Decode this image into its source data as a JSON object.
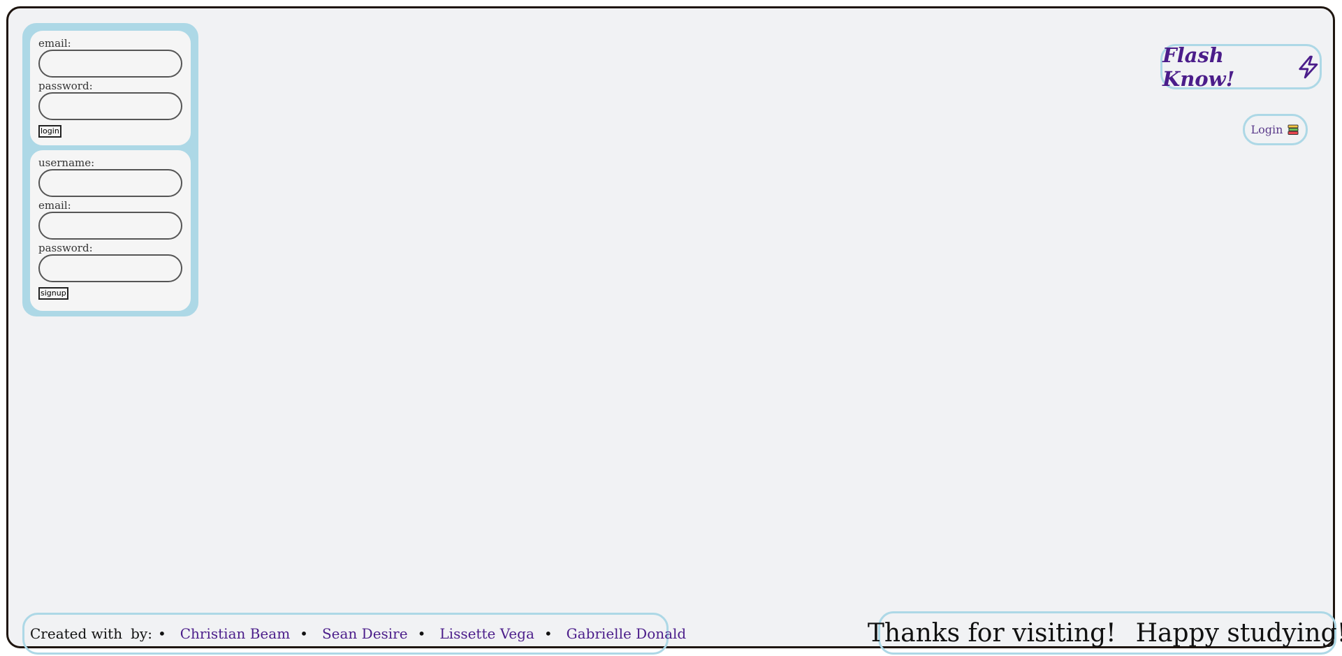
{
  "login_form": {
    "email_label": "email:",
    "password_label": "password:",
    "button_label": "login"
  },
  "signup_form": {
    "username_label": "username:",
    "email_label": "email:",
    "password_label": "password:",
    "button_label": "signup"
  },
  "header": {
    "brand_title": "Flash Know!",
    "brand_icon": "lightning-bolt-icon",
    "login_label": "Login",
    "login_icon": "books-icon"
  },
  "footer": {
    "created_with": "Created with",
    "by": "by:",
    "bullet": "•",
    "creators": [
      "Christian Beam",
      "Sean Desire",
      "Lissette Vega",
      "Gabrielle Donald"
    ],
    "thanks": "Thanks for visiting!",
    "studying": "Happy studying!"
  },
  "colors": {
    "accent_border": "#add8e6",
    "brand_purple": "#4b1d8a",
    "frame_border": "#1e150f",
    "heart_red": "#e8232e"
  }
}
